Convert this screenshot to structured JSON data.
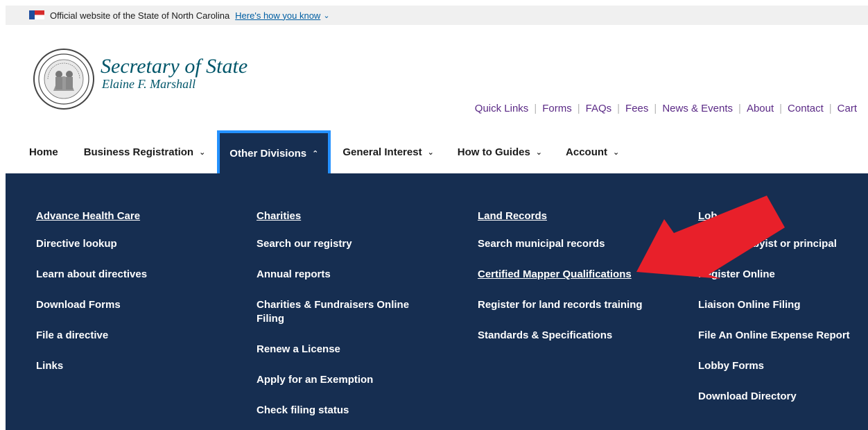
{
  "banner": {
    "text": "Official website of the State of North Carolina",
    "howto_link": "Here's how you know"
  },
  "brand": {
    "title": "Secretary of State",
    "subtitle": "Elaine F. Marshall"
  },
  "utility_links": [
    "Quick Links",
    "Forms",
    "FAQs",
    "Fees",
    "News & Events",
    "About",
    "Contact",
    "Cart"
  ],
  "nav": {
    "home": "Home",
    "business_registration": "Business Registration",
    "other_divisions": "Other Divisions",
    "general_interest": "General Interest",
    "how_to_guides": "How to Guides",
    "account": "Account"
  },
  "megamenu": {
    "advance_health_care": {
      "heading": "Advance Health Care",
      "links": [
        "Directive lookup",
        "Learn about directives",
        "Download Forms",
        "File a directive",
        "Links"
      ]
    },
    "charities": {
      "heading": "Charities",
      "links": [
        "Search our registry",
        "Annual reports",
        "Charities & Fundraisers Online Filing",
        "Renew a License",
        "Apply for an Exemption",
        "Check filing status"
      ]
    },
    "land_records": {
      "heading": "Land Records",
      "links": [
        "Search municipal records",
        "Certified Mapper Qualifications",
        "Register for land records training",
        "Standards & Specifications"
      ]
    },
    "lobbying": {
      "heading_visible": "Lob",
      "links": [
        "a lobbyist or principal",
        "Register Online",
        "Liaison Online Filing",
        "File An Online Expense Report",
        "Lobby Forms",
        "Download Directory"
      ]
    }
  },
  "colors": {
    "menu_bg": "#162e51",
    "active_border": "#2491ff",
    "brand_teal": "#00566a",
    "utility_purple": "#5b2a86",
    "annotation_arrow": "#e8202a"
  },
  "icons": [
    "nc-flag-icon",
    "chevron-down-icon",
    "chevron-up-icon",
    "state-seal-logo",
    "red-annotation-arrow"
  ]
}
